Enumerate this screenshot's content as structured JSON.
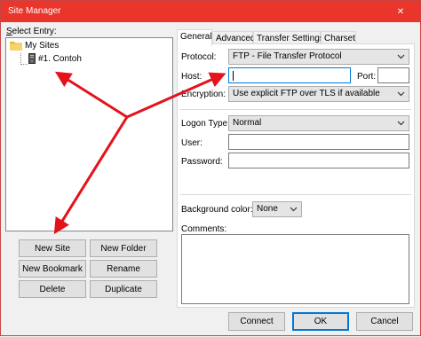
{
  "window": {
    "title": "Site Manager",
    "close_glyph": "✕"
  },
  "left": {
    "select_entry_label": "Select Entry:",
    "tree": {
      "root_label": "My Sites",
      "child_label": "#1. Contoh"
    },
    "buttons": {
      "new_site": "New Site",
      "new_folder": "New Folder",
      "new_bookmark": "New Bookmark",
      "rename": "Rename",
      "delete": "Delete",
      "duplicate": "Duplicate"
    }
  },
  "tabs": [
    "General",
    "Advanced",
    "Transfer Settings",
    "Charset"
  ],
  "general": {
    "protocol_label": "Protocol:",
    "protocol_value": "FTP - File Transfer Protocol",
    "host_label": "Host:",
    "host_value": "",
    "port_label": "Port:",
    "port_value": "",
    "encryption_label": "Encryption:",
    "encryption_value": "Use explicit FTP over TLS if available",
    "logon_type_label": "Logon Type:",
    "logon_type_value": "Normal",
    "user_label": "User:",
    "user_value": "",
    "password_label": "Password:",
    "password_value": "",
    "background_color_label": "Background color:",
    "background_color_value": "None",
    "comments_label": "Comments:",
    "comments_value": ""
  },
  "footer": {
    "connect": "Connect",
    "ok": "OK",
    "cancel": "Cancel"
  },
  "icons": {
    "folder": "folder-icon",
    "site": "server-icon",
    "chevron": "chevron-down-icon",
    "close": "close-icon"
  },
  "colors": {
    "titlebar": "#e9352a",
    "arrow": "#e4121b",
    "focus": "#0078d7"
  }
}
